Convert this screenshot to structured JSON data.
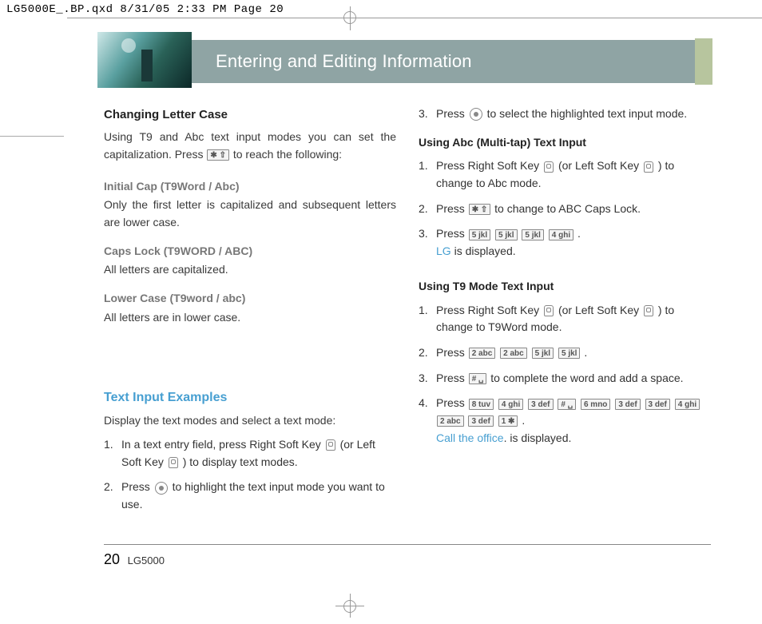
{
  "slug": "LG5000E_.BP.qxd  8/31/05  2:33 PM  Page 20",
  "banner_title": "Entering and Editing Information",
  "left": {
    "h1": "Changing Letter Case",
    "p1a": "Using T9 and Abc text input modes you can set the capitalization. Press ",
    "p1b": " to reach the following:",
    "key_star": "✱ ⇧",
    "sub1": "Initial Cap (T9Word / Abc)",
    "d1": "Only the first letter is capitalized and subsequent letters are lower case.",
    "sub2": "Caps Lock (T9WORD / ABC)",
    "d2": "All letters are capitalized.",
    "sub3": "Lower Case (T9word / abc)",
    "d3": "All letters are in lower case.",
    "h2": "Text Input Examples",
    "p2": "Display the text modes and select a text mode:",
    "s1a": "In a text entry field, press Right Soft Key ",
    "s1b": " (or Left Soft Key ",
    "s1c": " ) to display text modes.",
    "s2a": "Press ",
    "s2b": " to highlight the text input mode you want to use."
  },
  "right": {
    "s3a": "Press ",
    "s3b": " to select the highlighted text input mode.",
    "hA": "Using Abc (Multi-tap) Text Input",
    "a1a": "Press Right Soft Key ",
    "a1b": " (or Left Soft Key ",
    "a1c": " ) to change to Abc mode.",
    "a2a": "Press ",
    "a2b": " to change to ABC Caps Lock.",
    "a3a": "Press ",
    "a3b": ".",
    "a3blue": "LG",
    "a3c": " is displayed.",
    "k5": "5 jkl",
    "k4": "4 ghi",
    "hB": "Using T9 Mode Text Input",
    "b1a": "Press Right Soft Key ",
    "b1b": " (or Left Soft Key ",
    "b1c": " ) to change to T9Word mode.",
    "b2a": "Press ",
    "b2b": ".",
    "k2": "2 abc",
    "b3a": "Press ",
    "b3b": " to complete the word and add a space.",
    "khash": "# ␣",
    "b4a": "Press ",
    "b4b": ".",
    "k8": "8 tuv",
    "k3": "3 def",
    "k6": "6 mno",
    "k1": "1 ✱",
    "b4blue": "Call the office",
    "b4c": ". is displayed."
  },
  "footer": {
    "page": "20",
    "model": "LG5000"
  }
}
